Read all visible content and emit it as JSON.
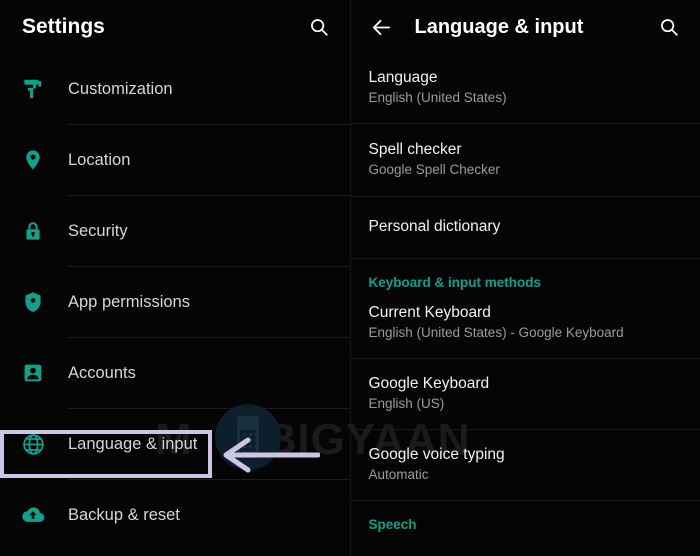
{
  "accent_colors": {
    "teal_icon": "#13a08a",
    "section_header": "#13a08a",
    "highlight_box": "#cdc5e3",
    "arrow": "#cdc5e3",
    "background": "#000000",
    "primary_text": "#f2f2f2",
    "secondary_text": "#9b9b9b"
  },
  "watermark": {
    "text_before": "M",
    "text_after": "BIGYAAN",
    "logo_name": "mobigyaan-phone-logo"
  },
  "left_panel": {
    "header": {
      "title": "Settings",
      "search_icon": "search-icon"
    },
    "items": [
      {
        "label": "Customization",
        "icon": "paint-roller-icon"
      },
      {
        "label": "Location",
        "icon": "location-pin-icon"
      },
      {
        "label": "Security",
        "icon": "lock-icon"
      },
      {
        "label": "App permissions",
        "icon": "shield-icon"
      },
      {
        "label": "Accounts",
        "icon": "account-badge-icon"
      },
      {
        "label": "Language & input",
        "icon": "globe-icon"
      },
      {
        "label": "Backup & reset",
        "icon": "cloud-upload-icon"
      }
    ],
    "highlighted_item": "Language & input"
  },
  "right_panel": {
    "header": {
      "back_icon": "back-arrow-icon",
      "title": "Language & input",
      "search_icon": "search-icon"
    },
    "items": [
      {
        "title": "Language",
        "subtitle": "English (United States)"
      },
      {
        "title": "Spell checker",
        "subtitle": "Google Spell Checker"
      },
      {
        "title": "Personal dictionary",
        "subtitle": ""
      }
    ],
    "section_keyboard": {
      "header": "Keyboard & input methods",
      "items": [
        {
          "title": "Current Keyboard",
          "subtitle": "English (United States) - Google Keyboard"
        },
        {
          "title": "Google Keyboard",
          "subtitle": "English (US)"
        },
        {
          "title": "Google voice typing",
          "subtitle": "Automatic"
        }
      ]
    },
    "section_speech": {
      "header": "Speech"
    },
    "highlighted_item": "Google Keyboard"
  }
}
